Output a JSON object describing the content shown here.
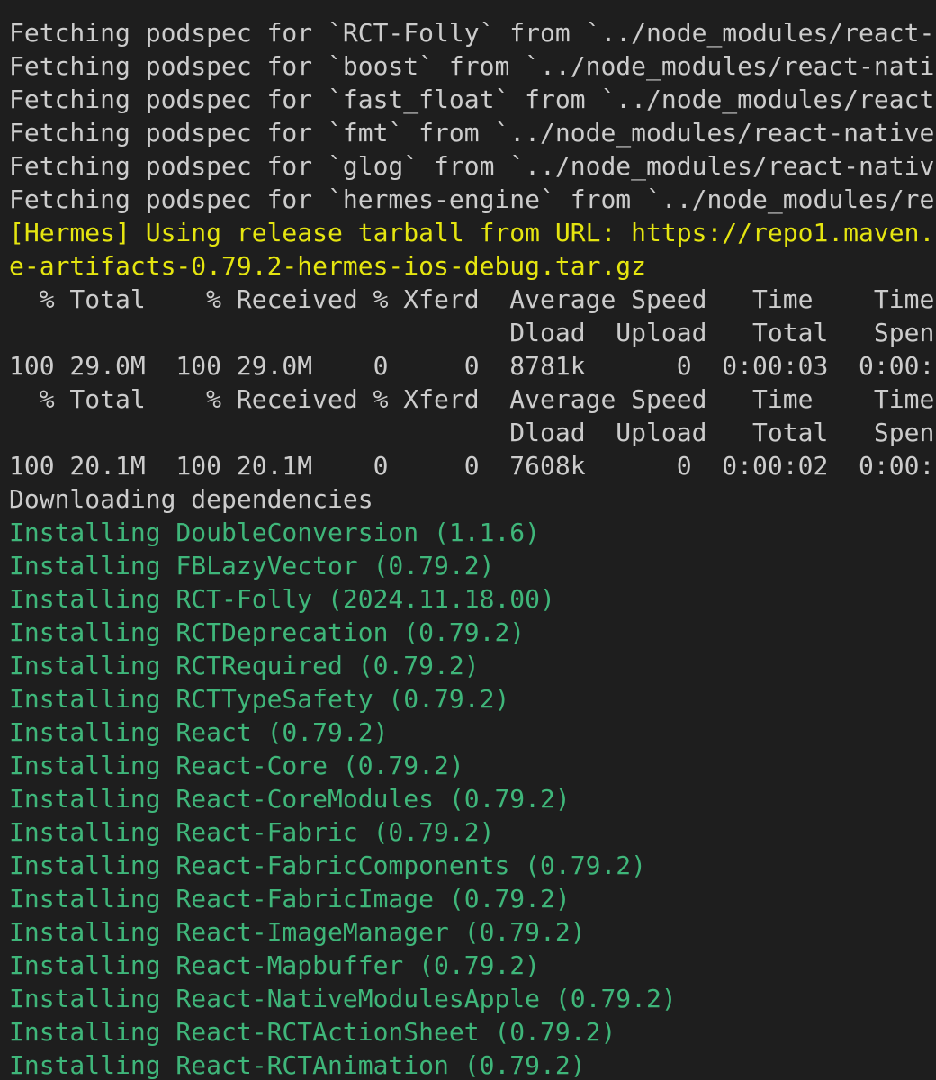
{
  "terminal": {
    "colors": {
      "background": "#1e1e1e",
      "default": "#cccccc",
      "yellow": "#e5e510",
      "green": "#3fb67a"
    },
    "lines": [
      {
        "text": "Fetching podspec for `RCT-Folly` from `../node_modules/react-",
        "color": "default"
      },
      {
        "text": "Fetching podspec for `boost` from `../node_modules/react-nati",
        "color": "default"
      },
      {
        "text": "Fetching podspec for `fast_float` from `../node_modules/react",
        "color": "default"
      },
      {
        "text": "Fetching podspec for `fmt` from `../node_modules/react-native",
        "color": "default"
      },
      {
        "text": "Fetching podspec for `glog` from `../node_modules/react-nativ",
        "color": "default"
      },
      {
        "text": "Fetching podspec for `hermes-engine` from `../node_modules/re",
        "color": "default"
      },
      {
        "text": "[Hermes] Using release tarball from URL: https://repo1.maven.",
        "color": "yellow"
      },
      {
        "text": "e-artifacts-0.79.2-hermes-ios-debug.tar.gz",
        "color": "yellow"
      },
      {
        "text": "  % Total    % Received % Xferd  Average Speed   Time    Time",
        "color": "default"
      },
      {
        "text": "                                 Dload  Upload   Total   Spen",
        "color": "default"
      },
      {
        "text": "100 29.0M  100 29.0M    0     0  8781k      0  0:00:03  0:00:",
        "color": "default"
      },
      {
        "text": "  % Total    % Received % Xferd  Average Speed   Time    Time",
        "color": "default"
      },
      {
        "text": "                                 Dload  Upload   Total   Spen",
        "color": "default"
      },
      {
        "text": "100 20.1M  100 20.1M    0     0  7608k      0  0:00:02  0:00:",
        "color": "default"
      },
      {
        "text": "Downloading dependencies",
        "color": "default"
      },
      {
        "text": "Installing DoubleConversion (1.1.6)",
        "color": "green"
      },
      {
        "text": "Installing FBLazyVector (0.79.2)",
        "color": "green"
      },
      {
        "text": "Installing RCT-Folly (2024.11.18.00)",
        "color": "green"
      },
      {
        "text": "Installing RCTDeprecation (0.79.2)",
        "color": "green"
      },
      {
        "text": "Installing RCTRequired (0.79.2)",
        "color": "green"
      },
      {
        "text": "Installing RCTTypeSafety (0.79.2)",
        "color": "green"
      },
      {
        "text": "Installing React (0.79.2)",
        "color": "green"
      },
      {
        "text": "Installing React-Core (0.79.2)",
        "color": "green"
      },
      {
        "text": "Installing React-CoreModules (0.79.2)",
        "color": "green"
      },
      {
        "text": "Installing React-Fabric (0.79.2)",
        "color": "green"
      },
      {
        "text": "Installing React-FabricComponents (0.79.2)",
        "color": "green"
      },
      {
        "text": "Installing React-FabricImage (0.79.2)",
        "color": "green"
      },
      {
        "text": "Installing React-ImageManager (0.79.2)",
        "color": "green"
      },
      {
        "text": "Installing React-Mapbuffer (0.79.2)",
        "color": "green"
      },
      {
        "text": "Installing React-NativeModulesApple (0.79.2)",
        "color": "green"
      },
      {
        "text": "Installing React-RCTActionSheet (0.79.2)",
        "color": "green"
      },
      {
        "text": "Installing React-RCTAnimation (0.79.2)",
        "color": "green"
      }
    ]
  }
}
